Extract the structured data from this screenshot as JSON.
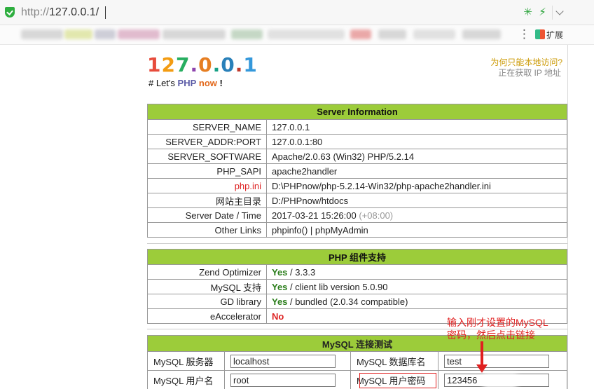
{
  "browser": {
    "url_proto": "http://",
    "url_host": "127.0.0.1/",
    "extensions_label": "扩展"
  },
  "header": {
    "logo_chars": [
      {
        "ch": "1",
        "color": "#e74c3c"
      },
      {
        "ch": "2",
        "color": "#f39c12"
      },
      {
        "ch": "7",
        "color": "#27ae60"
      },
      {
        "ch": ".",
        "color": "#8e44ad"
      },
      {
        "ch": "0",
        "color": "#e67e22"
      },
      {
        "ch": ".",
        "color": "#16a085"
      },
      {
        "ch": "0",
        "color": "#2980b9"
      },
      {
        "ch": ".",
        "color": "#c0392b"
      },
      {
        "ch": "1",
        "color": "#3498db"
      }
    ],
    "tag_prefix": "# Let's",
    "tag_php": "PHP",
    "tag_now": "now",
    "tag_bang": "!",
    "why_local": "为何只能本地访问?",
    "getting_ip": "正在获取 IP 地址"
  },
  "server_info": {
    "title": "Server Information",
    "rows": [
      {
        "key": "SERVER_NAME",
        "value": "127.0.0.1"
      },
      {
        "key": "SERVER_ADDR:PORT",
        "value": "127.0.0.1:80"
      },
      {
        "key": "SERVER_SOFTWARE",
        "value": "Apache/2.0.63 (Win32) PHP/5.2.14"
      },
      {
        "key": "PHP_SAPI",
        "value": "apache2handler"
      },
      {
        "key": "php.ini",
        "value": "D:\\PHPnow/php-5.2.14-Win32/php-apache2handler.ini"
      },
      {
        "key": "网站主目录",
        "value": "D:/PHPnow/htdocs"
      },
      {
        "key": "Server Date / Time",
        "value": "2017-03-21 15:26:00",
        "tz": "(+08:00)"
      },
      {
        "key": "Other Links",
        "link1": "phpinfo()",
        "sep": " | ",
        "link2": "phpMyAdmin"
      }
    ]
  },
  "php_components": {
    "title": "PHP 组件支持",
    "rows": [
      {
        "key": "Zend Optimizer",
        "status": "Yes",
        "detail": " / 3.3.3"
      },
      {
        "key": "MySQL 支持",
        "status": "Yes",
        "detail": " / client lib version 5.0.90"
      },
      {
        "key": "GD library",
        "status": "Yes",
        "detail": " / bundled (2.0.34 compatible)"
      },
      {
        "key": "eAccelerator",
        "status": "No",
        "detail": ""
      }
    ]
  },
  "mysql_test": {
    "title": "MySQL 连接测试",
    "server_label": "MySQL 服务器",
    "server_value": "localhost",
    "db_label": "MySQL 数据库名",
    "db_value": "test",
    "user_label": "MySQL 用户名",
    "user_value": "root",
    "pass_label": "MySQL 用户密码",
    "pass_value": "123456"
  },
  "annotation": {
    "line1": "输入刚才设置的MySQL",
    "line2": "密码，然后点击链接",
    "color": "#e02020"
  },
  "colors": {
    "table_header_bg": "#9ccc3a",
    "yes": "#2a7d1a",
    "no": "#dd2222"
  }
}
